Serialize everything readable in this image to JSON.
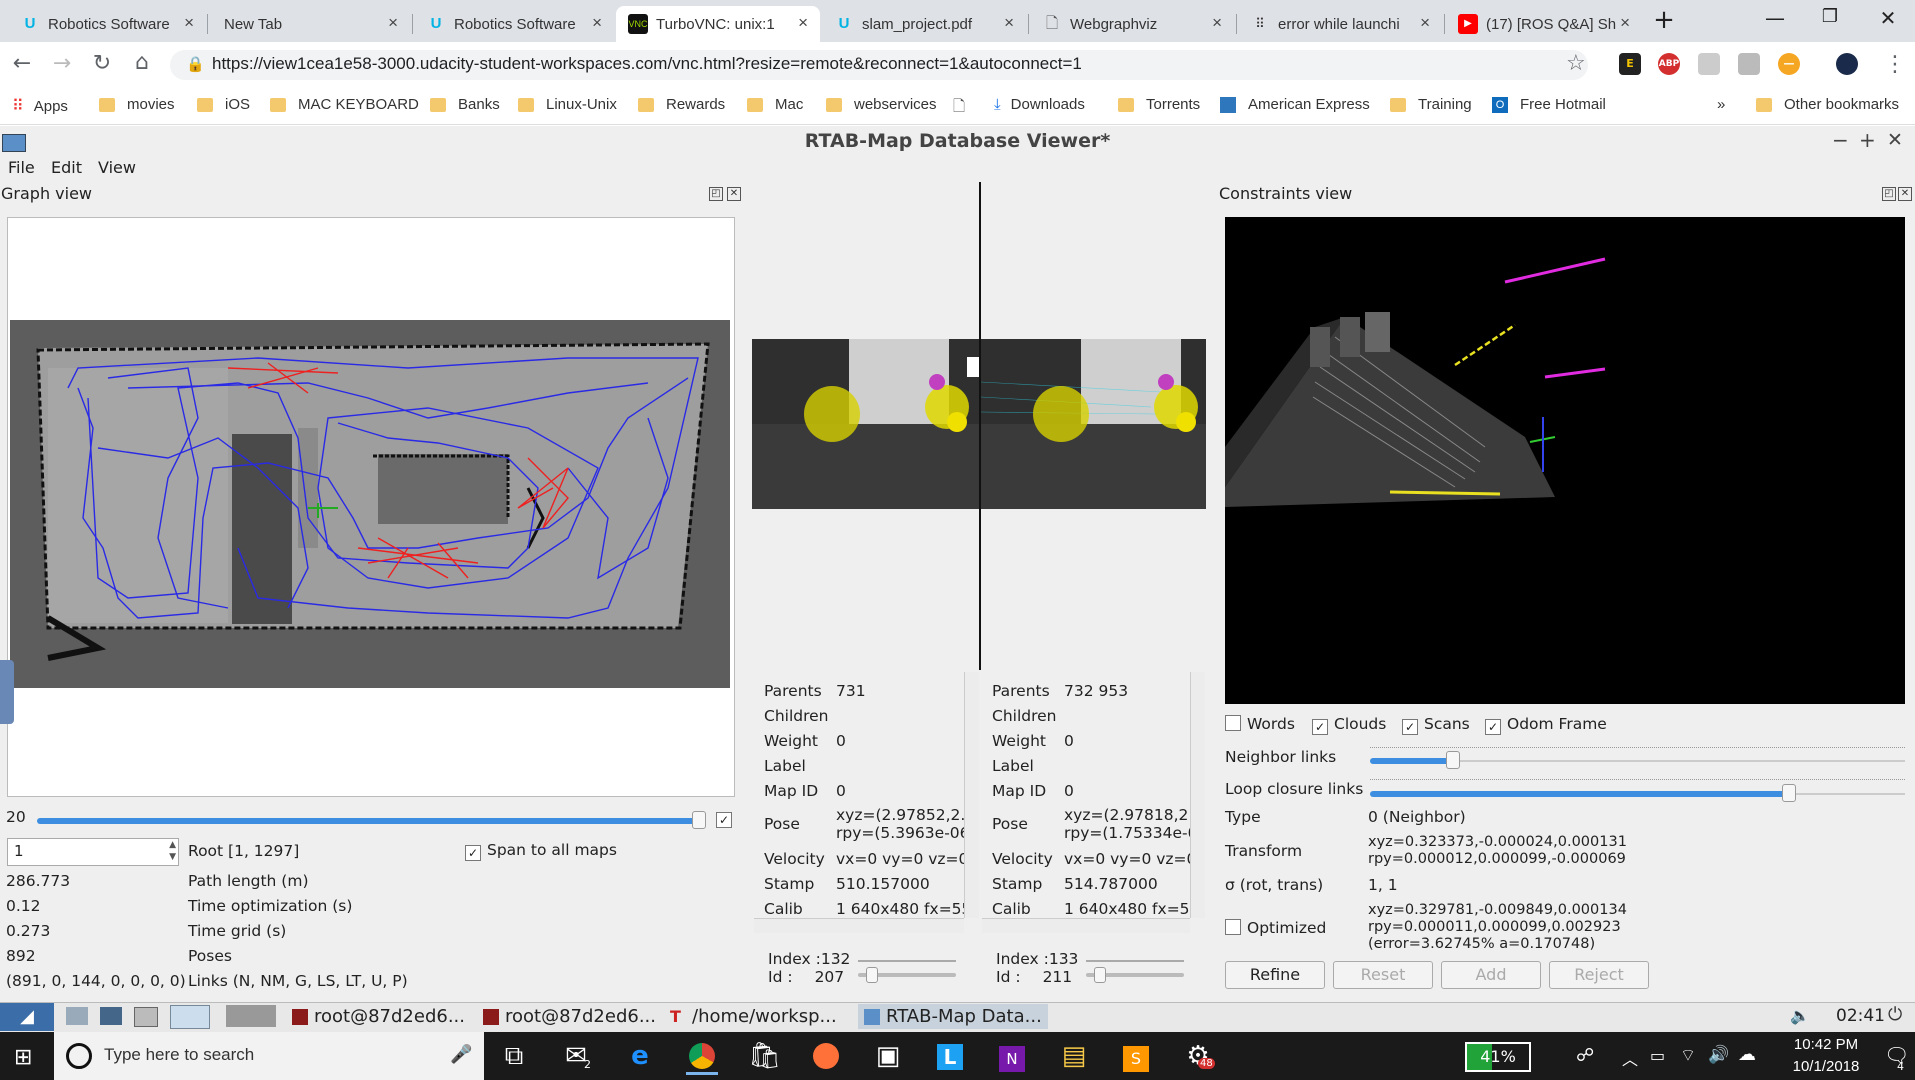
{
  "browser": {
    "tabs": [
      {
        "title": "Robotics Software",
        "icon": "udacity-icon",
        "active": false
      },
      {
        "title": "New Tab",
        "icon": "",
        "active": false
      },
      {
        "title": "Robotics Software",
        "icon": "udacity-icon",
        "active": false
      },
      {
        "title": "TurboVNC: unix:1",
        "icon": "vnc-icon",
        "active": true
      },
      {
        "title": "slam_project.pdf",
        "icon": "udacity-icon",
        "active": false
      },
      {
        "title": "Webgraphviz",
        "icon": "page-icon",
        "active": false
      },
      {
        "title": "error while launchi",
        "icon": "dots-icon",
        "active": false
      },
      {
        "title": "(17) [ROS Q&A] Sh",
        "icon": "youtube-icon",
        "active": false
      }
    ],
    "new_tab": "+",
    "url": "https://view1cea1e58-3000.udacity-student-workspaces.com/vnc.html?resize=remote&reconnect=1&autoconnect=1",
    "bookmarks": [
      "Apps",
      "movies",
      "iOS",
      "MAC KEYBOARD",
      "Banks",
      "Linux-Unix",
      "Rewards",
      "Mac",
      "webservices",
      "Downloads",
      "Torrents",
      "American Express",
      "Training",
      "Free Hotmail"
    ],
    "bookmarks_overflow": "»",
    "other_bookmarks": "Other bookmarks",
    "ext_abp": "ABP"
  },
  "app": {
    "title": "RTAB-Map Database Viewer*",
    "menu": [
      "File",
      "Edit",
      "View"
    ],
    "graph_view": {
      "header": "Graph view",
      "slider_value": "20",
      "spin_value": "1",
      "root": "Root [1, 1297]",
      "span_label": "Span to all maps",
      "stats": [
        {
          "value": "286.773",
          "label": "Path length (m)"
        },
        {
          "value": "0.12",
          "label": "Time optimization (s)"
        },
        {
          "value": "0.273",
          "label": "Time grid (s)"
        },
        {
          "value": "892",
          "label": "Poses"
        },
        {
          "value": "(891, 0, 144, 0, 0, 0, 0)",
          "label": "Links (N, NM, G, LS, LT, U, P)"
        }
      ]
    },
    "left_node": {
      "parents": "731",
      "children": "",
      "weight": "0",
      "label": "",
      "map_id": "0",
      "pose_xyz": "xyz=(2.97852,2.",
      "pose_rpy": "rpy=(5.3963e-06",
      "velocity": "vx=0 vy=0 vz=0",
      "stamp": "510.157000",
      "calib": "1 640x480 fx=55",
      "index": "132",
      "id": "207"
    },
    "right_node": {
      "parents": "732 953",
      "children": "",
      "weight": "0",
      "label": "",
      "map_id": "0",
      "pose_xyz": "xyz=(2.97818,2.",
      "pose_rpy": "rpy=(1.75334e-0",
      "velocity": "vx=0 vy=0 vz=0",
      "stamp": "514.787000",
      "calib": "1 640x480 fx=55",
      "index": "133",
      "id": "211"
    },
    "prop_labels": {
      "parents": "Parents",
      "children": "Children",
      "weight": "Weight",
      "label": "Label",
      "map_id": "Map ID",
      "pose": "Pose",
      "velocity": "Velocity",
      "stamp": "Stamp",
      "calib": "Calib",
      "index": "Index :",
      "id": "Id :"
    },
    "constraints": {
      "header": "Constraints view",
      "checks": [
        {
          "label": "Words",
          "checked": false
        },
        {
          "label": "Clouds",
          "checked": true
        },
        {
          "label": "Scans",
          "checked": true
        },
        {
          "label": "Odom Frame",
          "checked": true
        }
      ],
      "neighbor_links": "Neighbor links",
      "loop_links": "Loop closure links",
      "type_label": "Type",
      "type_value": "0 (Neighbor)",
      "transform_label": "Transform",
      "transform_xyz": "xyz=0.323373,-0.000024,0.000131",
      "transform_rpy": "rpy=0.000012,0.000099,-0.000069",
      "sigma_label": "σ (rot, trans)",
      "sigma_value": "1, 1",
      "optimized_label": "Optimized",
      "optimized_xyz": "xyz=0.329781,-0.009849,0.000134",
      "optimized_rpy": "rpy=0.000011,0.000099,0.002923",
      "optimized_error": "(error=3.62745% a=0.170748)",
      "buttons": [
        "Refine",
        "Reset",
        "Add",
        "Reject"
      ]
    }
  },
  "vnc_panel": {
    "tasks": [
      "root@87d2ed6...",
      "root@87d2ed6...",
      "/home/worksp...",
      "RTAB-Map Data..."
    ],
    "clock": "02:41"
  },
  "windows": {
    "search_placeholder": "Type here to search",
    "battery": "41%",
    "time": "10:42 PM",
    "date": "10/1/2018",
    "mail_badge": "2",
    "chrome_badge": "48",
    "notif_badge": "4"
  }
}
